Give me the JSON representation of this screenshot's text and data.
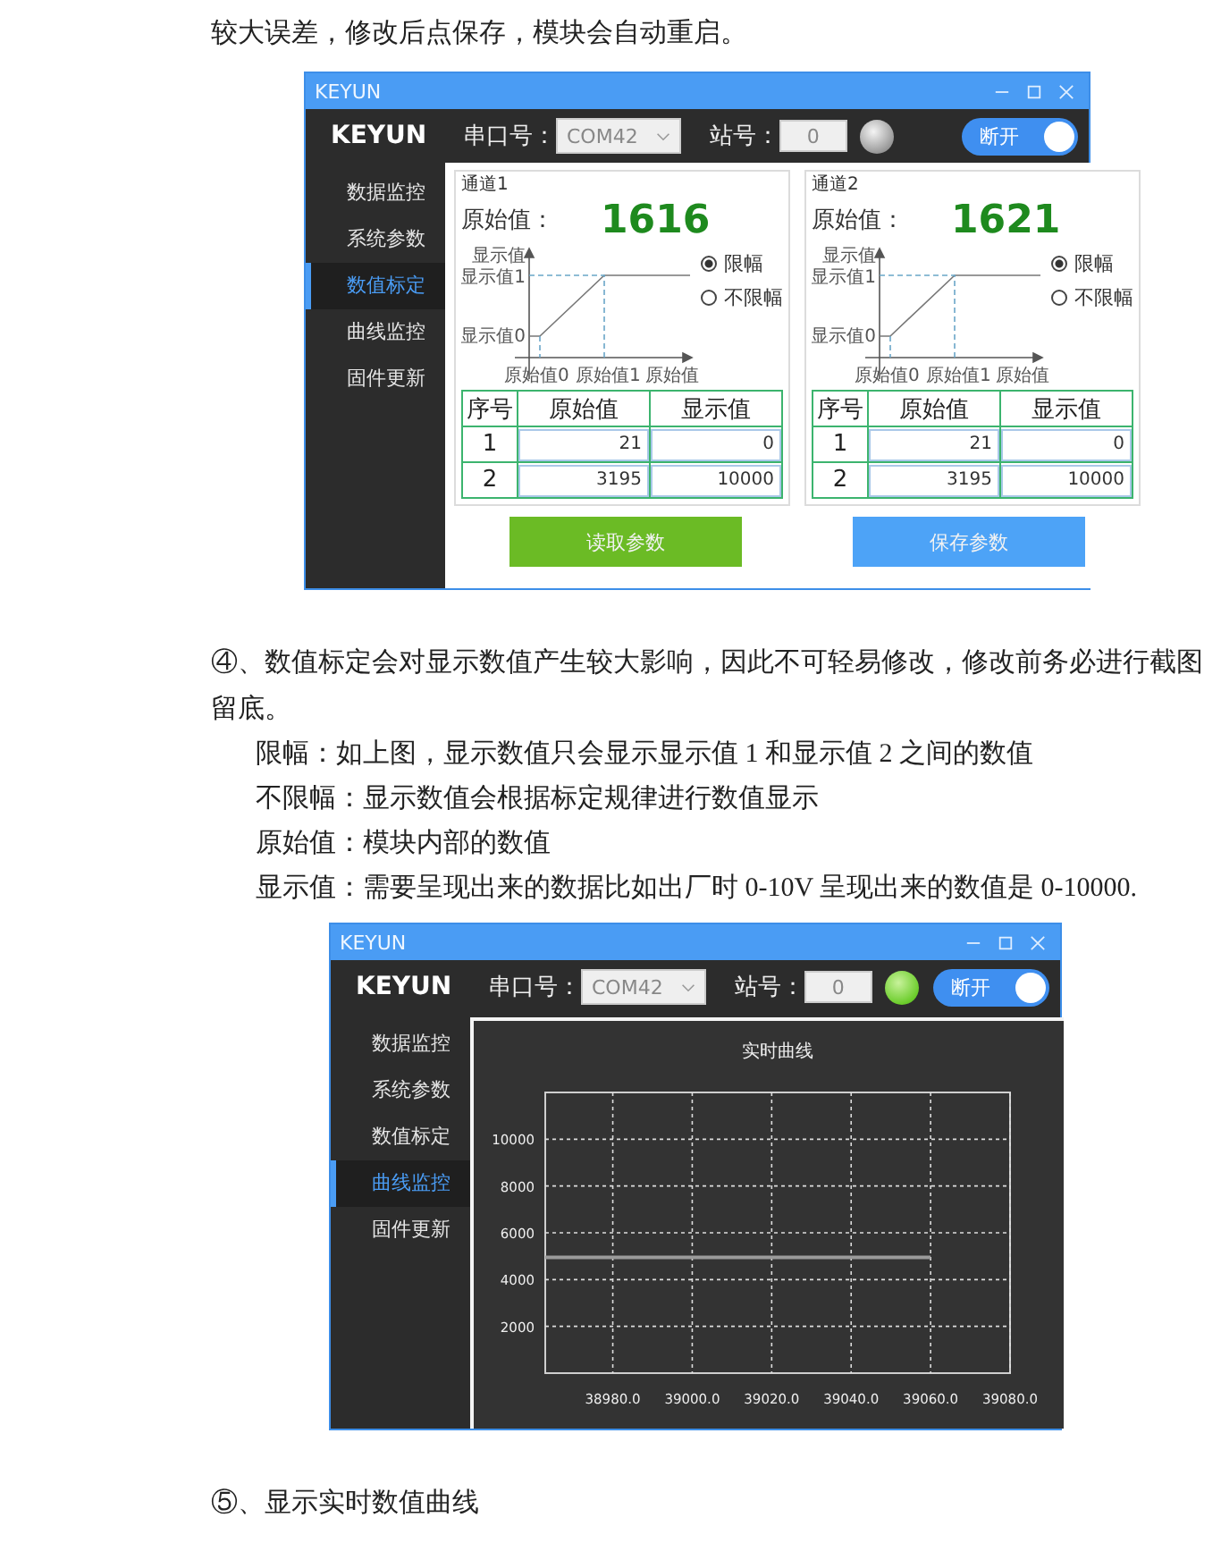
{
  "blocks": [
    {
      "kind": "paragraph",
      "text": "较大误差，修改后点保存，模块会自动重启。"
    },
    {
      "kind": "window",
      "title": "KEYUN",
      "header": {
        "logo": "KEYUN",
        "port_label": "串口号：",
        "port_value": "COM42",
        "station_label": "站号：",
        "station_value": "0",
        "indicator_lit": false,
        "toggle": {
          "label": "断开",
          "on": true
        }
      },
      "sidebar": [
        {
          "label": "数据监控",
          "selected": false
        },
        {
          "label": "系统参数",
          "selected": false
        },
        {
          "label": "数值标定",
          "selected": true
        },
        {
          "label": "曲线监控",
          "selected": false
        },
        {
          "label": "固件更新",
          "selected": false
        }
      ],
      "content": {
        "kind": "calibration",
        "channels": [
          {
            "title": "通道1",
            "raw_label": "原始值：",
            "raw_value": "1616",
            "diagram": {
              "y_axis": "显示值",
              "y1": "显示值1",
              "y0": "显示值0",
              "x0": "原始值0",
              "x1": "原始值1",
              "x_axis": "原始值"
            },
            "options": [
              {
                "label": "限幅",
                "selected": true
              },
              {
                "label": "不限幅",
                "selected": false
              }
            ],
            "columns": [
              "序号",
              "原始值",
              "显示值"
            ],
            "rows": [
              [
                "1",
                "21",
                "0"
              ],
              [
                "2",
                "3195",
                "10000"
              ]
            ]
          },
          {
            "title": "通道2",
            "raw_label": "原始值：",
            "raw_value": "1621",
            "diagram": {
              "y_axis": "显示值",
              "y1": "显示值1",
              "y0": "显示值0",
              "x0": "原始值0",
              "x1": "原始值1",
              "x_axis": "原始值"
            },
            "options": [
              {
                "label": "限幅",
                "selected": true
              },
              {
                "label": "不限幅",
                "selected": false
              }
            ],
            "columns": [
              "序号",
              "原始值",
              "显示值"
            ],
            "rows": [
              [
                "1",
                "21",
                "0"
              ],
              [
                "2",
                "3195",
                "10000"
              ]
            ]
          }
        ],
        "buttons": [
          {
            "label": "读取参数",
            "color": "#6bbb25"
          },
          {
            "label": "保存参数",
            "color": "#4da3f7"
          }
        ]
      }
    },
    {
      "kind": "paragraph",
      "text": "④、数值标定会对显示数值产生较大影响，因此不可轻易修改，修改前务必进行截图留底。"
    },
    {
      "kind": "definitions",
      "items": [
        "限幅：如上图，显示数值只会显示显示值 1 和显示值 2 之间的数值",
        "不限幅：显示数值会根据标定规律进行数值显示",
        "原始值：模块内部的数值",
        "显示值：需要呈现出来的数据比如出厂时 0-10V 呈现出来的数值是 0-10000."
      ]
    },
    {
      "kind": "window",
      "title": "KEYUN",
      "header": {
        "logo": "KEYUN",
        "port_label": "串口号：",
        "port_value": "COM42",
        "station_label": "站号：",
        "station_value": "0",
        "indicator_lit": true,
        "toggle": {
          "label": "断开",
          "on": true
        }
      },
      "sidebar": [
        {
          "label": "数据监控",
          "selected": false
        },
        {
          "label": "系统参数",
          "selected": false
        },
        {
          "label": "数值标定",
          "selected": false
        },
        {
          "label": "曲线监控",
          "selected": true
        },
        {
          "label": "固件更新",
          "selected": false
        }
      ],
      "content": {
        "kind": "curve",
        "chart_data": {
          "type": "line",
          "title": "实时曲线",
          "xlim": [
            38963,
            39080
          ],
          "ylim": [
            0,
            12000
          ],
          "xticks": [
            {
              "value": 38980,
              "label": "38980.0"
            },
            {
              "value": 39000,
              "label": "39000.0"
            },
            {
              "value": 39020,
              "label": "39020.0"
            },
            {
              "value": 39040,
              "label": "39040.0"
            },
            {
              "value": 39060,
              "label": "39060.0"
            },
            {
              "value": 39080,
              "label": "39080.0"
            }
          ],
          "yticks": [
            2000,
            4000,
            6000,
            8000,
            10000
          ],
          "x": [
            38963,
            39060
          ],
          "grid": true,
          "series": [
            {
              "color": "#9a9a9a",
              "values": [
                4950,
                4950
              ]
            }
          ]
        }
      }
    },
    {
      "kind": "paragraph",
      "text": "⑤、显示实时数值曲线"
    }
  ]
}
